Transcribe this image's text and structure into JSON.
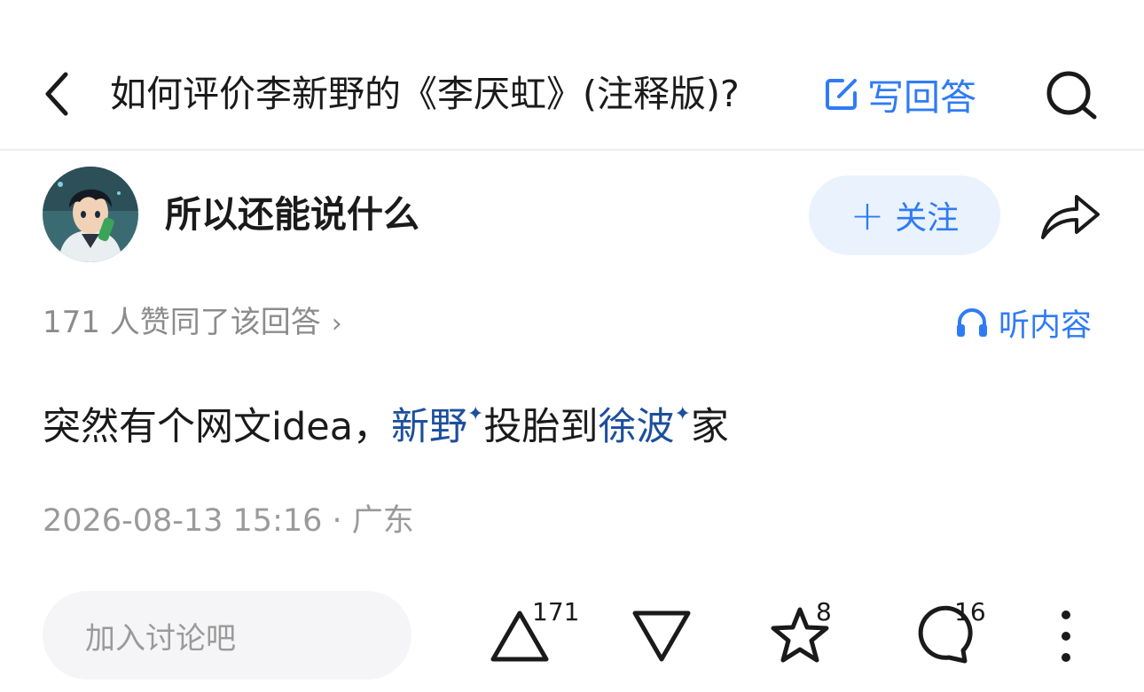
{
  "header": {
    "back_icon": "chevron-left-icon",
    "question_title": "如何评价李新野的《李厌虹》(注释版)?",
    "write_answer_label": "写回答",
    "write_icon": "edit-icon",
    "search_icon": "search-icon"
  },
  "author": {
    "avatar_icon": "avatar",
    "name": "所以还能说什么",
    "follow_plus": "+",
    "follow_label": "关注",
    "share_icon": "share-icon"
  },
  "stats": {
    "votes_text": "171 人赞同了该回答",
    "chevron": "›",
    "listen_label": "听内容",
    "listen_icon": "headphones-icon"
  },
  "answer": {
    "part1": "突然有个网文idea，",
    "keyword1": "新野",
    "spark": "✦",
    "part2": "投胎到",
    "keyword2": "徐波",
    "part3": "家"
  },
  "meta": {
    "datetime_location": "2026-08-13 15:16 · 广东"
  },
  "bottom_bar": {
    "comment_placeholder": "加入讨论吧",
    "upvote_count": "171",
    "favorite_count": "8",
    "comment_count": "16"
  },
  "colors": {
    "accent": "#2f7bf5",
    "keyword": "#1c4f9c",
    "muted": "#8c8c8c"
  }
}
